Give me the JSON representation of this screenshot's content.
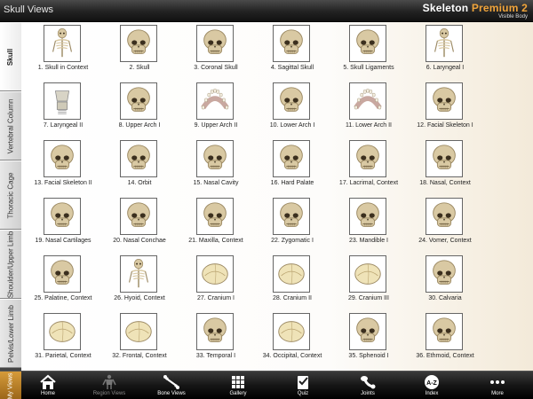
{
  "header": {
    "title": "Skull Views",
    "brand_main": "Skeleton ",
    "brand_accent": "Premium 2",
    "brand_sub": "Visible Body"
  },
  "side_tabs": [
    {
      "label": "Skull",
      "active": true
    },
    {
      "label": "Vertebral Column",
      "active": false
    },
    {
      "label": "Thoracic Cage",
      "active": false
    },
    {
      "label": "Shoulder/Upper Limb",
      "active": false
    },
    {
      "label": "Pelvis/Lower Limb",
      "active": false
    }
  ],
  "my_views_label": "My Views",
  "views": [
    {
      "label": "1. Skull in Context",
      "icon": "skeleton-icon"
    },
    {
      "label": "2. Skull",
      "icon": "skull-icon"
    },
    {
      "label": "3. Coronal Skull",
      "icon": "skull-icon"
    },
    {
      "label": "4. Sagittal Skull",
      "icon": "skull-icon"
    },
    {
      "label": "5. Skull Ligaments",
      "icon": "skull-icon"
    },
    {
      "label": "6. Laryngeal I",
      "icon": "skeleton-icon"
    },
    {
      "label": "7. Laryngeal II",
      "icon": "larynx-icon"
    },
    {
      "label": "8. Upper Arch I",
      "icon": "skull-icon"
    },
    {
      "label": "9. Upper Arch II",
      "icon": "teeth-icon"
    },
    {
      "label": "10. Lower Arch I",
      "icon": "skull-icon"
    },
    {
      "label": "11. Lower Arch II",
      "icon": "teeth-icon"
    },
    {
      "label": "12. Facial Skeleton I",
      "icon": "skull-icon"
    },
    {
      "label": "13. Facial Skeleton II",
      "icon": "skull-icon"
    },
    {
      "label": "14. Orbit",
      "icon": "skull-icon"
    },
    {
      "label": "15. Nasal Cavity",
      "icon": "skull-icon"
    },
    {
      "label": "16. Hard Palate",
      "icon": "skull-icon"
    },
    {
      "label": "17. Lacrimal, Context",
      "icon": "skull-icon"
    },
    {
      "label": "18. Nasal, Context",
      "icon": "skull-icon"
    },
    {
      "label": "19. Nasal Cartilages",
      "icon": "skull-icon"
    },
    {
      "label": "20. Nasal Conchae",
      "icon": "skull-icon"
    },
    {
      "label": "21. Maxilla, Context",
      "icon": "skull-icon"
    },
    {
      "label": "22. Zygomatic I",
      "icon": "skull-icon"
    },
    {
      "label": "23. Mandible I",
      "icon": "skull-icon"
    },
    {
      "label": "24. Vomer, Context",
      "icon": "skull-icon"
    },
    {
      "label": "25. Palatine, Context",
      "icon": "skull-icon"
    },
    {
      "label": "26. Hyoid, Context",
      "icon": "skeleton-icon"
    },
    {
      "label": "27. Cranium I",
      "icon": "cranium-icon"
    },
    {
      "label": "28. Cranium II",
      "icon": "cranium-icon"
    },
    {
      "label": "29. Cranium III",
      "icon": "cranium-icon"
    },
    {
      "label": "30. Calvaria",
      "icon": "skull-icon"
    },
    {
      "label": "31. Parietal, Context",
      "icon": "cranium-icon"
    },
    {
      "label": "32. Frontal, Context",
      "icon": "cranium-icon"
    },
    {
      "label": "33. Temporal I",
      "icon": "skull-icon"
    },
    {
      "label": "34. Occipital, Context",
      "icon": "cranium-icon"
    },
    {
      "label": "35. Sphenoid I",
      "icon": "skull-icon"
    },
    {
      "label": "36. Ethmoid, Context",
      "icon": "skull-icon"
    }
  ],
  "toolbar": [
    {
      "label": "Home",
      "icon": "home-icon",
      "dim": false
    },
    {
      "label": "Region Views",
      "icon": "region-views-icon",
      "dim": true
    },
    {
      "label": "Bone Views",
      "icon": "bone-views-icon",
      "dim": false
    },
    {
      "label": "Gallery",
      "icon": "gallery-icon",
      "dim": false
    },
    {
      "label": "Quiz",
      "icon": "quiz-icon",
      "dim": false
    },
    {
      "label": "Joints",
      "icon": "joints-icon",
      "dim": false
    },
    {
      "label": "Index",
      "icon": "index-icon",
      "dim": false
    },
    {
      "label": "More",
      "icon": "more-icon",
      "dim": false
    }
  ],
  "colors": {
    "accent": "#f0a43a",
    "bone": "#d9c9a3",
    "bone_shadow": "#9c8a64"
  }
}
